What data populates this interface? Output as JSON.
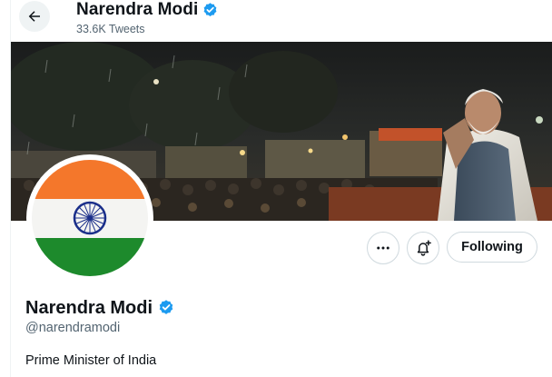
{
  "header": {
    "name": "Narendra Modi",
    "tweet_count": "33.6K Tweets",
    "back_icon": "arrow-left-icon",
    "verified_icon": "verified-badge-icon"
  },
  "banner": {
    "description_icon": "banner-photo"
  },
  "actions": {
    "more_icon": "more-dots-icon",
    "notify_icon": "bell-plus-icon",
    "follow_label": "Following"
  },
  "profile": {
    "name": "Narendra Modi",
    "handle": "@narendramodi",
    "bio": "Prime Minister of India",
    "verified_icon": "verified-badge-icon"
  },
  "colors": {
    "verified_blue": "#1d9bf0",
    "secondary_text": "#536471",
    "border": "#cfd9de",
    "saffron": "#f4772b",
    "green": "#1d8a2c",
    "chakra": "#1b2f8a"
  }
}
